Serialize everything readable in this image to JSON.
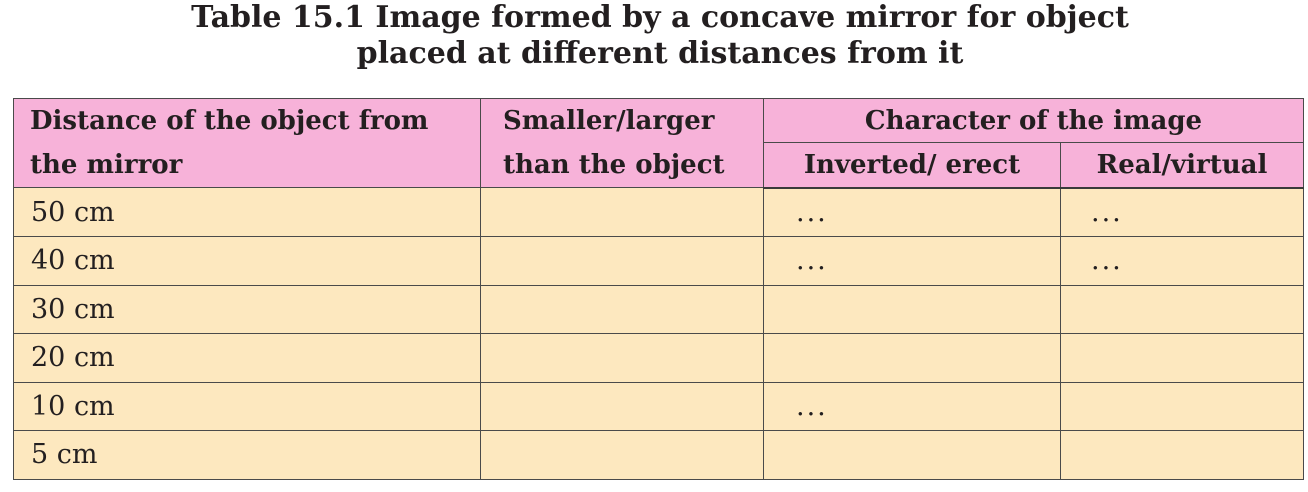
{
  "caption": {
    "line1": "Table 15.1 Image formed by a concave mirror for object",
    "line2": "placed at different distances from it"
  },
  "table": {
    "headers": {
      "distance_line1": "Distance of the object from",
      "distance_line2": "the mirror",
      "size_line1": "Smaller/larger",
      "size_line2": "than the object",
      "character": "Character of the image",
      "inverted": "Inverted/ erect",
      "real": "Real/virtual"
    },
    "rows": [
      {
        "distance": "50 cm",
        "size": "",
        "inverted": "...",
        "real": "..."
      },
      {
        "distance": "40 cm",
        "size": "",
        "inverted": "...",
        "real": "..."
      },
      {
        "distance": "30 cm",
        "size": "",
        "inverted": "",
        "real": ""
      },
      {
        "distance": "20 cm",
        "size": "",
        "inverted": "",
        "real": ""
      },
      {
        "distance": "10 cm",
        "size": "",
        "inverted": "...",
        "real": ""
      },
      {
        "distance": "5 cm",
        "size": "",
        "inverted": "",
        "real": ""
      }
    ]
  },
  "colors": {
    "header_background": "#f7b2d9",
    "body_background": "#fde8bf",
    "border": "#4a4a4a"
  }
}
